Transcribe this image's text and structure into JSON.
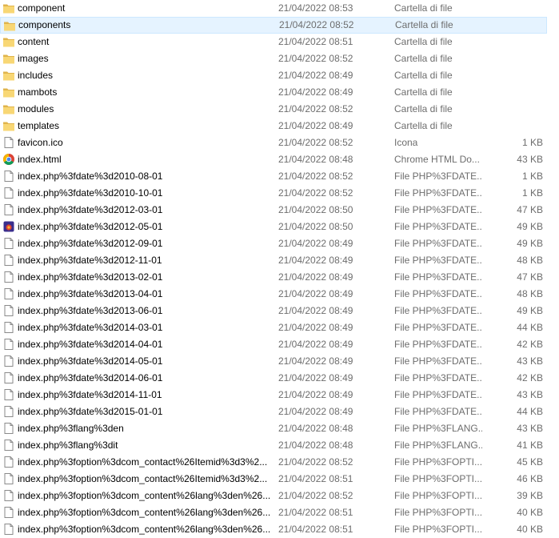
{
  "file_list": {
    "rows": [
      {
        "name": "component",
        "modified": "21/04/2022 08:53",
        "type": "Cartella di file",
        "size": "",
        "icon": "folder-icon"
      },
      {
        "name": "components",
        "modified": "21/04/2022 08:52",
        "type": "Cartella di file",
        "size": "",
        "icon": "folder-icon",
        "selected": true
      },
      {
        "name": "content",
        "modified": "21/04/2022 08:51",
        "type": "Cartella di file",
        "size": "",
        "icon": "folder-icon"
      },
      {
        "name": "images",
        "modified": "21/04/2022 08:52",
        "type": "Cartella di file",
        "size": "",
        "icon": "folder-icon"
      },
      {
        "name": "includes",
        "modified": "21/04/2022 08:49",
        "type": "Cartella di file",
        "size": "",
        "icon": "folder-icon"
      },
      {
        "name": "mambots",
        "modified": "21/04/2022 08:49",
        "type": "Cartella di file",
        "size": "",
        "icon": "folder-icon"
      },
      {
        "name": "modules",
        "modified": "21/04/2022 08:52",
        "type": "Cartella di file",
        "size": "",
        "icon": "folder-icon"
      },
      {
        "name": "templates",
        "modified": "21/04/2022 08:49",
        "type": "Cartella di file",
        "size": "",
        "icon": "folder-icon"
      },
      {
        "name": "favicon.ico",
        "modified": "21/04/2022 08:52",
        "type": "Icona",
        "size": "1 KB",
        "icon": "file-icon"
      },
      {
        "name": "index.html",
        "modified": "21/04/2022 08:48",
        "type": "Chrome HTML Do...",
        "size": "43 KB",
        "icon": "chrome-icon"
      },
      {
        "name": "index.php%3fdate%3d2010-08-01",
        "modified": "21/04/2022 08:52",
        "type": "File PHP%3FDATE...",
        "size": "1 KB",
        "icon": "file-icon"
      },
      {
        "name": "index.php%3fdate%3d2010-10-01",
        "modified": "21/04/2022 08:52",
        "type": "File PHP%3FDATE...",
        "size": "1 KB",
        "icon": "file-icon"
      },
      {
        "name": "index.php%3fdate%3d2012-03-01",
        "modified": "21/04/2022 08:50",
        "type": "File PHP%3FDATE...",
        "size": "47 KB",
        "icon": "file-icon"
      },
      {
        "name": "index.php%3fdate%3d2012-05-01",
        "modified": "21/04/2022 08:50",
        "type": "File PHP%3FDATE...",
        "size": "49 KB",
        "icon": "app-icon"
      },
      {
        "name": "index.php%3fdate%3d2012-09-01",
        "modified": "21/04/2022 08:49",
        "type": "File PHP%3FDATE...",
        "size": "49 KB",
        "icon": "file-icon"
      },
      {
        "name": "index.php%3fdate%3d2012-11-01",
        "modified": "21/04/2022 08:49",
        "type": "File PHP%3FDATE...",
        "size": "48 KB",
        "icon": "file-icon"
      },
      {
        "name": "index.php%3fdate%3d2013-02-01",
        "modified": "21/04/2022 08:49",
        "type": "File PHP%3FDATE...",
        "size": "47 KB",
        "icon": "file-icon"
      },
      {
        "name": "index.php%3fdate%3d2013-04-01",
        "modified": "21/04/2022 08:49",
        "type": "File PHP%3FDATE...",
        "size": "48 KB",
        "icon": "file-icon"
      },
      {
        "name": "index.php%3fdate%3d2013-06-01",
        "modified": "21/04/2022 08:49",
        "type": "File PHP%3FDATE...",
        "size": "49 KB",
        "icon": "file-icon"
      },
      {
        "name": "index.php%3fdate%3d2014-03-01",
        "modified": "21/04/2022 08:49",
        "type": "File PHP%3FDATE...",
        "size": "44 KB",
        "icon": "file-icon"
      },
      {
        "name": "index.php%3fdate%3d2014-04-01",
        "modified": "21/04/2022 08:49",
        "type": "File PHP%3FDATE...",
        "size": "42 KB",
        "icon": "file-icon"
      },
      {
        "name": "index.php%3fdate%3d2014-05-01",
        "modified": "21/04/2022 08:49",
        "type": "File PHP%3FDATE...",
        "size": "43 KB",
        "icon": "file-icon"
      },
      {
        "name": "index.php%3fdate%3d2014-06-01",
        "modified": "21/04/2022 08:49",
        "type": "File PHP%3FDATE...",
        "size": "42 KB",
        "icon": "file-icon"
      },
      {
        "name": "index.php%3fdate%3d2014-11-01",
        "modified": "21/04/2022 08:49",
        "type": "File PHP%3FDATE...",
        "size": "43 KB",
        "icon": "file-icon"
      },
      {
        "name": "index.php%3fdate%3d2015-01-01",
        "modified": "21/04/2022 08:49",
        "type": "File PHP%3FDATE...",
        "size": "44 KB",
        "icon": "file-icon"
      },
      {
        "name": "index.php%3flang%3den",
        "modified": "21/04/2022 08:48",
        "type": "File PHP%3FLANG...",
        "size": "43 KB",
        "icon": "file-icon"
      },
      {
        "name": "index.php%3flang%3dit",
        "modified": "21/04/2022 08:48",
        "type": "File PHP%3FLANG...",
        "size": "41 KB",
        "icon": "file-icon"
      },
      {
        "name": "index.php%3foption%3dcom_contact%26Itemid%3d3%2...",
        "modified": "21/04/2022 08:52",
        "type": "File PHP%3FOPTI...",
        "size": "45 KB",
        "icon": "file-icon"
      },
      {
        "name": "index.php%3foption%3dcom_contact%26Itemid%3d3%2...",
        "modified": "21/04/2022 08:51",
        "type": "File PHP%3FOPTI...",
        "size": "46 KB",
        "icon": "file-icon"
      },
      {
        "name": "index.php%3foption%3dcom_content%26lang%3den%26...",
        "modified": "21/04/2022 08:52",
        "type": "File PHP%3FOPTI...",
        "size": "39 KB",
        "icon": "file-icon"
      },
      {
        "name": "index.php%3foption%3dcom_content%26lang%3den%26...",
        "modified": "21/04/2022 08:51",
        "type": "File PHP%3FOPTI...",
        "size": "40 KB",
        "icon": "file-icon"
      },
      {
        "name": "index.php%3foption%3dcom_content%26lang%3den%26...",
        "modified": "21/04/2022 08:51",
        "type": "File PHP%3FOPTI...",
        "size": "40 KB",
        "icon": "file-icon"
      }
    ]
  },
  "colors": {
    "folder": "#f8d775",
    "folder_dark": "#e0b44c",
    "selected_bg": "#e5f3ff",
    "selected_border": "#cce8ff",
    "secondary_text": "#6d6d6d"
  }
}
